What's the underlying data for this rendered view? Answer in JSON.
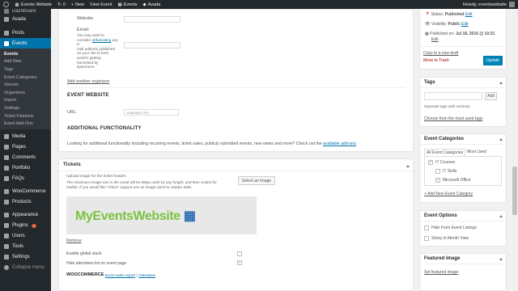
{
  "adminbar": {
    "site_name": "Events Website",
    "updates": "0",
    "new": "New",
    "view": "View Event",
    "events": "Events",
    "avada": "Avada",
    "howdy": "Howdy, eventswebsite"
  },
  "sidebar": {
    "top_cut": "Dashboard",
    "items_before": [
      {
        "label": "Avada"
      },
      {
        "label": "Posts"
      }
    ],
    "current": "Events",
    "submenu": [
      "Events",
      "Add New",
      "Tags",
      "Event Categories",
      "Venues",
      "Organizers",
      "Import",
      "Settings",
      "Ticket Fieldsets",
      "Event Add-Ons"
    ],
    "items_after": [
      {
        "label": "Media"
      },
      {
        "label": "Pages"
      },
      {
        "label": "Comments"
      },
      {
        "label": "Portfolio"
      },
      {
        "label": "FAQs"
      },
      {
        "label": "WooCommerce"
      },
      {
        "label": "Products"
      },
      {
        "label": "Appearance"
      },
      {
        "label": "Plugins",
        "badge": "1"
      },
      {
        "label": "Users"
      },
      {
        "label": "Tools"
      },
      {
        "label": "Settings"
      },
      {
        "label": "Collapse menu"
      }
    ]
  },
  "organizer": {
    "website_label": "Website:",
    "email_label": "Email:",
    "email_note_1": "You may want to",
    "email_note_2": "consider",
    "email_note_link": "obfuscating",
    "email_note_3": "any e-",
    "email_note_4": "mail address published",
    "email_note_5": "on your site to best",
    "email_note_6": "avoid it getting",
    "email_note_7": "harvested by",
    "email_note_8": "spammers.",
    "add_another": "Add another organizer"
  },
  "event_website": {
    "heading": "EVENT WEBSITE",
    "url_label": "URL:",
    "url_placeholder": "example.com"
  },
  "additional": {
    "heading": "ADDITIONAL FUNCTIONALITY",
    "text": "Looking for additional functionality including recurring events, ticket sales, publicly submitted events, new views and more? Check out the",
    "link": "available add-ons",
    "end": "."
  },
  "tickets": {
    "title": "Tickets",
    "upload_text": "Upload image for the ticket header.",
    "max_text_1": "The maximum image size in the email will be 580px wide by any height, and then scaled for",
    "max_text_2": "mobile. If you would like \"retina\" support use an image sized to 1160px wide.",
    "select_button": "Select an Image",
    "logo_text": "MyEventsWebsite",
    "remove": "Remove",
    "global_stock": "Enable global stock",
    "hide_attendees": "Hide attendees list on event page",
    "woocommerce": "WOOCOMMERCE",
    "sales_report": "Event sales report",
    "separator": "|",
    "attendees": "Attendees"
  },
  "publish": {
    "status_label": "Status:",
    "status_value": "Published",
    "edit": "Edit",
    "visibility_label": "Visibility:",
    "visibility_value": "Public",
    "published_label": "Published on:",
    "published_value": "Jul 18, 2016 @ 10:31",
    "copy_draft": "Copy to a new draft",
    "trash": "Move to Trash",
    "update": "Update"
  },
  "tags": {
    "title": "Tags",
    "add": "Add",
    "hint": "Separate tags with commas",
    "choose": "Choose from the most used tags"
  },
  "categories": {
    "title": "Event Categories",
    "tab_all": "All Event Categories",
    "tab_most": "Most Used",
    "items": [
      {
        "label": "IT Courses",
        "checked": "true",
        "level": "0"
      },
      {
        "label": "IT Skills",
        "checked": "false",
        "level": "1"
      },
      {
        "label": "Microsoft Office",
        "checked": "true",
        "level": "1"
      }
    ],
    "add_new": "+ Add New Event Category"
  },
  "event_options": {
    "title": "Event Options",
    "hide_listings": "Hide From Event Listings",
    "sticky": "Sticky in Month View"
  },
  "featured": {
    "title": "Featured Image",
    "set": "Set featured image"
  },
  "colors": {
    "admin_bg": "#23282d",
    "accent": "#0073aa",
    "trash": "#a00",
    "logo_green": "#7cc242",
    "logo_blue": "#2e6fb7"
  }
}
